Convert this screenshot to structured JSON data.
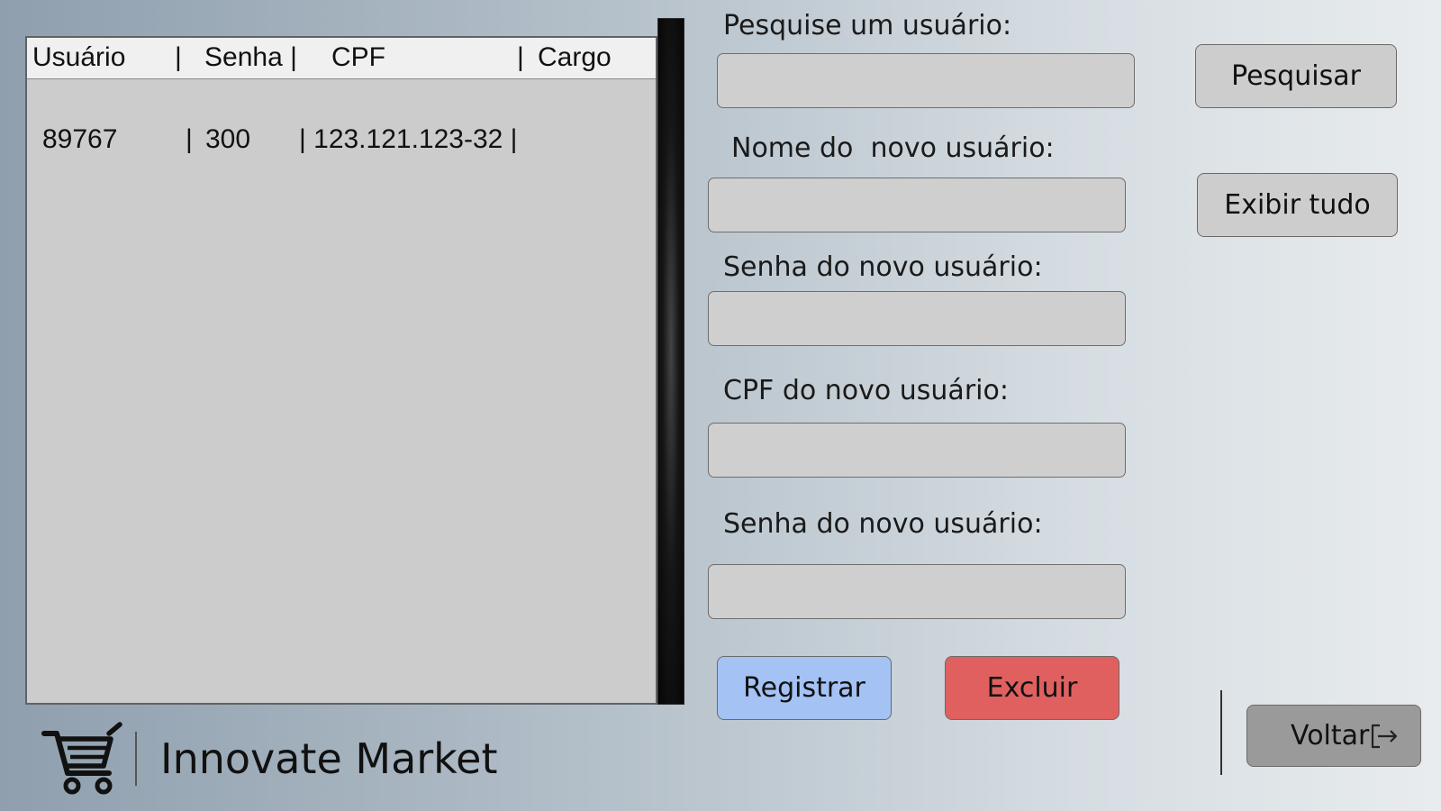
{
  "table": {
    "headers": {
      "usuario": "Usuário",
      "sep1": "|",
      "senha": "Senha |",
      "cpf": "CPF",
      "sep2": "|",
      "cargo": "Cargo"
    },
    "rows": [
      {
        "usuario": "89767",
        "sep1": "|",
        "senha": "300",
        "cpf": "| 123.121.123-32 |"
      }
    ]
  },
  "form": {
    "search_label": "Pesquise um usuário:",
    "search_value": "",
    "name_label": "Nome do  novo usuário:",
    "name_value": "",
    "password_label": "Senha do novo usuário:",
    "password_value": "",
    "cpf_label": "CPF do novo usuário:",
    "cpf_value": "",
    "password2_label": "Senha do novo usuário:",
    "password2_value": ""
  },
  "buttons": {
    "search": "Pesquisar",
    "show_all": "Exibir tudo",
    "register": "Registrar",
    "delete": "Excluir",
    "back": "Voltar"
  },
  "brand": {
    "name": "Innovate Market",
    "logo_icon": "shopping-cart-icon"
  },
  "icons": {
    "back": "exit-arrow-icon"
  },
  "colors": {
    "register_button": "#a4c2f4",
    "delete_button": "#e06060",
    "back_button": "#9a9a9a"
  }
}
